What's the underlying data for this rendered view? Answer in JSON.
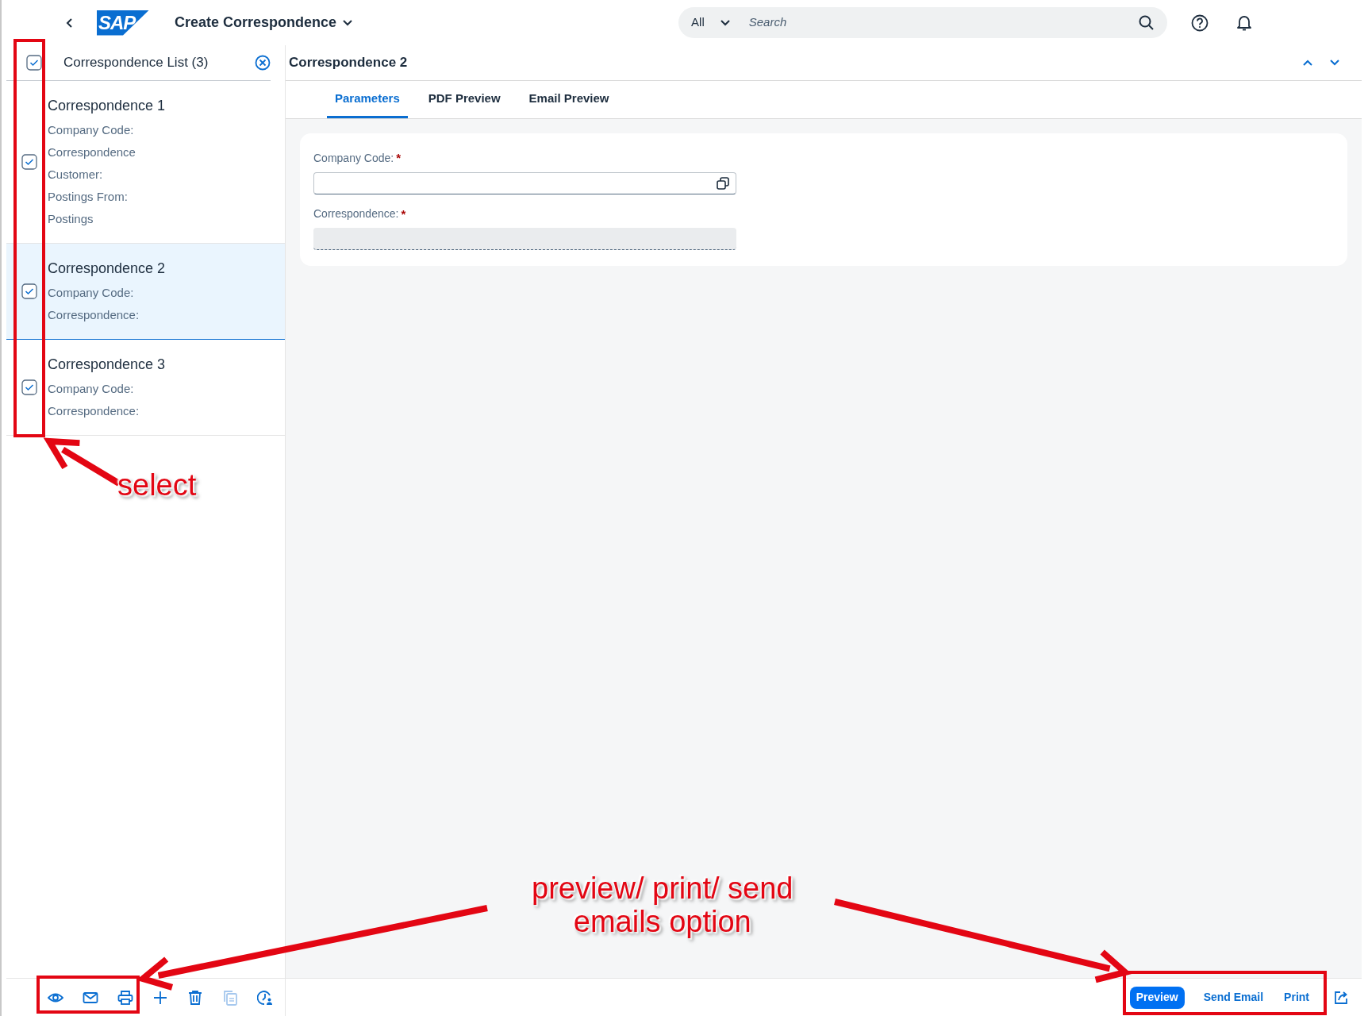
{
  "shell": {
    "logo": "SAP",
    "title": "Create Correspondence",
    "search": {
      "scope": "All",
      "placeholder": "Search"
    }
  },
  "list": {
    "title": "Correspondence List (3)",
    "select_all_checked": true,
    "items": [
      {
        "title": "Correspondence 1",
        "selected": false,
        "checked": true,
        "fields": [
          "Company Code:",
          "Correspondence",
          "Customer:",
          "Postings From:",
          "Postings"
        ]
      },
      {
        "title": "Correspondence 2",
        "selected": true,
        "checked": true,
        "fields": [
          "Company Code:",
          "Correspondence:"
        ]
      },
      {
        "title": "Correspondence 3",
        "selected": false,
        "checked": true,
        "fields": [
          "Company Code:",
          "Correspondence:"
        ]
      }
    ]
  },
  "detail": {
    "title": "Correspondence 2",
    "tabs": [
      {
        "label": "Parameters",
        "selected": true
      },
      {
        "label": "PDF Preview",
        "selected": false
      },
      {
        "label": "Email Preview",
        "selected": false
      }
    ],
    "fields": [
      {
        "label": "Company Code:",
        "required_mark": "*",
        "kind": "value-help"
      },
      {
        "label": "Correspondence:",
        "required_mark": "*",
        "kind": "readonly"
      }
    ]
  },
  "footer": {
    "tools": [
      {
        "kind": "preview",
        "disabled": false
      },
      {
        "kind": "email",
        "disabled": false
      },
      {
        "kind": "print",
        "disabled": false
      },
      {
        "kind": "add",
        "disabled": false
      },
      {
        "kind": "delete",
        "disabled": false
      },
      {
        "kind": "copy",
        "disabled": true
      },
      {
        "kind": "history",
        "disabled": false
      }
    ],
    "actions": [
      {
        "label": "Preview",
        "kind": "emphasized"
      },
      {
        "label": "Send Email",
        "kind": "transparent"
      },
      {
        "label": "Print",
        "kind": "transparent"
      }
    ]
  },
  "annotations": [
    {
      "kind": "select",
      "lines": [
        "select"
      ]
    },
    {
      "kind": "output",
      "lines": [
        "preview/ print/ send",
        "emails option"
      ]
    }
  ]
}
